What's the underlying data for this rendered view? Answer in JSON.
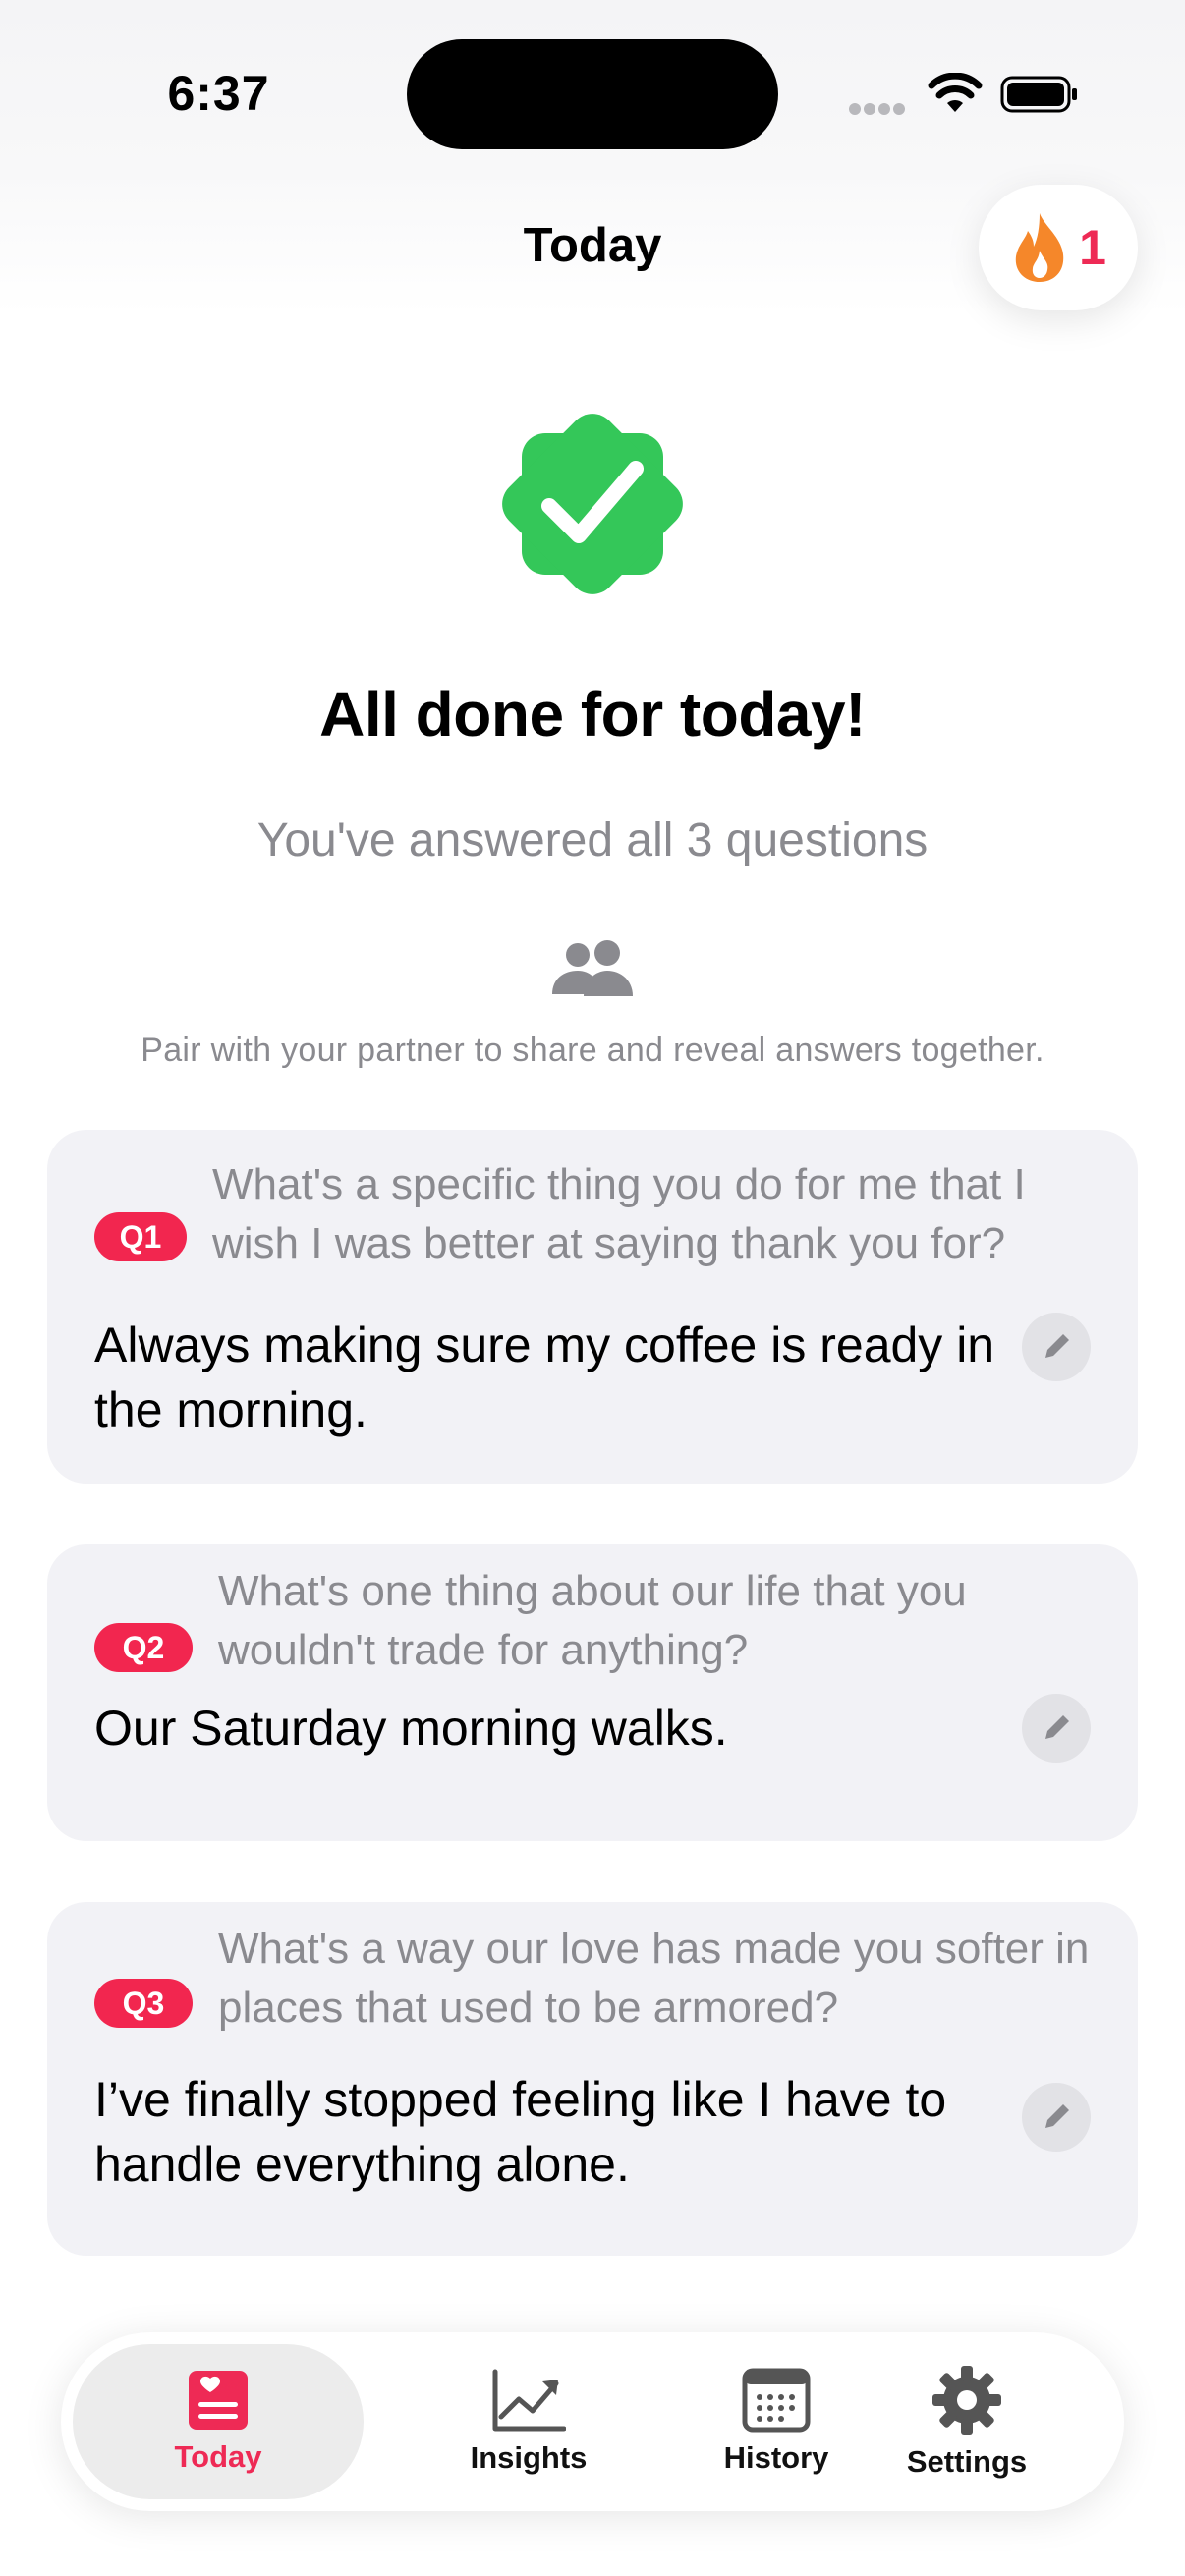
{
  "status_bar": {
    "time": "6:37"
  },
  "header": {
    "title": "Today",
    "streak_count": "1"
  },
  "completion": {
    "title": "All done for today!",
    "subtitle": "You've answered all 3 questions",
    "pair_prompt": "Pair with your partner to share and reveal answers together."
  },
  "questions": [
    {
      "badge": "Q1",
      "question": "What's a specific thing you do for me that I wish I was better at saying thank you for?",
      "answer": "Always making sure my coffee is ready in the morning."
    },
    {
      "badge": "Q2",
      "question": "What's one thing about our life that you wouldn't trade for anything?",
      "answer": "Our Saturday morning walks."
    },
    {
      "badge": "Q3",
      "question": "What's a way our love has made you softer in places that used to be armored?",
      "answer": "I’ve finally stopped feeling like I have to handle everything alone."
    }
  ],
  "tabs": [
    {
      "label": "Today",
      "icon": "heart-note-icon",
      "active": true
    },
    {
      "label": "Insights",
      "icon": "chart-line-icon",
      "active": false
    },
    {
      "label": "History",
      "icon": "calendar-icon",
      "active": false
    },
    {
      "label": "Settings",
      "icon": "gear-icon",
      "active": false
    }
  ],
  "colors": {
    "accent": "#ee2a55",
    "success": "#34c759",
    "card_bg": "#f2f2f6",
    "secondary_text": "#8a8a8f",
    "flame": "#f5872a"
  }
}
